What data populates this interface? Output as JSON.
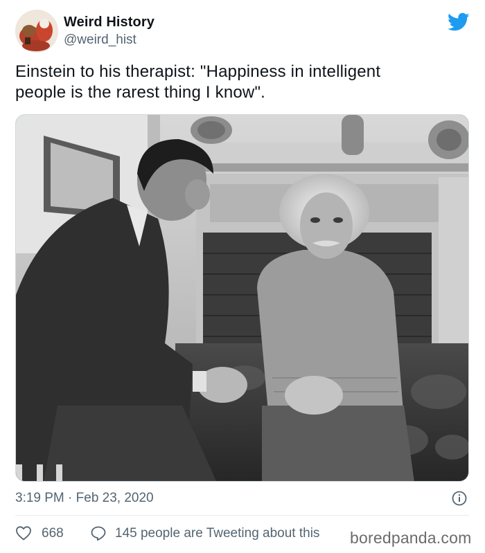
{
  "author": {
    "name": "Weird History",
    "handle": "@weird_hist"
  },
  "tweet": {
    "text_lines": [
      "Einstein to his therapist: \"Happiness in intelligent",
      "people is the rarest thing I know\"."
    ],
    "timestamp": "3:19 PM · Feb 23, 2020"
  },
  "actions": {
    "like_count": "668",
    "reply_text": "145 people are Tweeting about this"
  },
  "watermark": "boredpanda.com",
  "icons": {
    "brand": "twitter-bird-icon",
    "like": "heart-icon",
    "reply": "speech-bubble-icon",
    "info": "info-icon"
  },
  "colors": {
    "twitter_blue": "#1d9bf0",
    "secondary_text": "#536471",
    "primary_text": "#0f1419"
  }
}
